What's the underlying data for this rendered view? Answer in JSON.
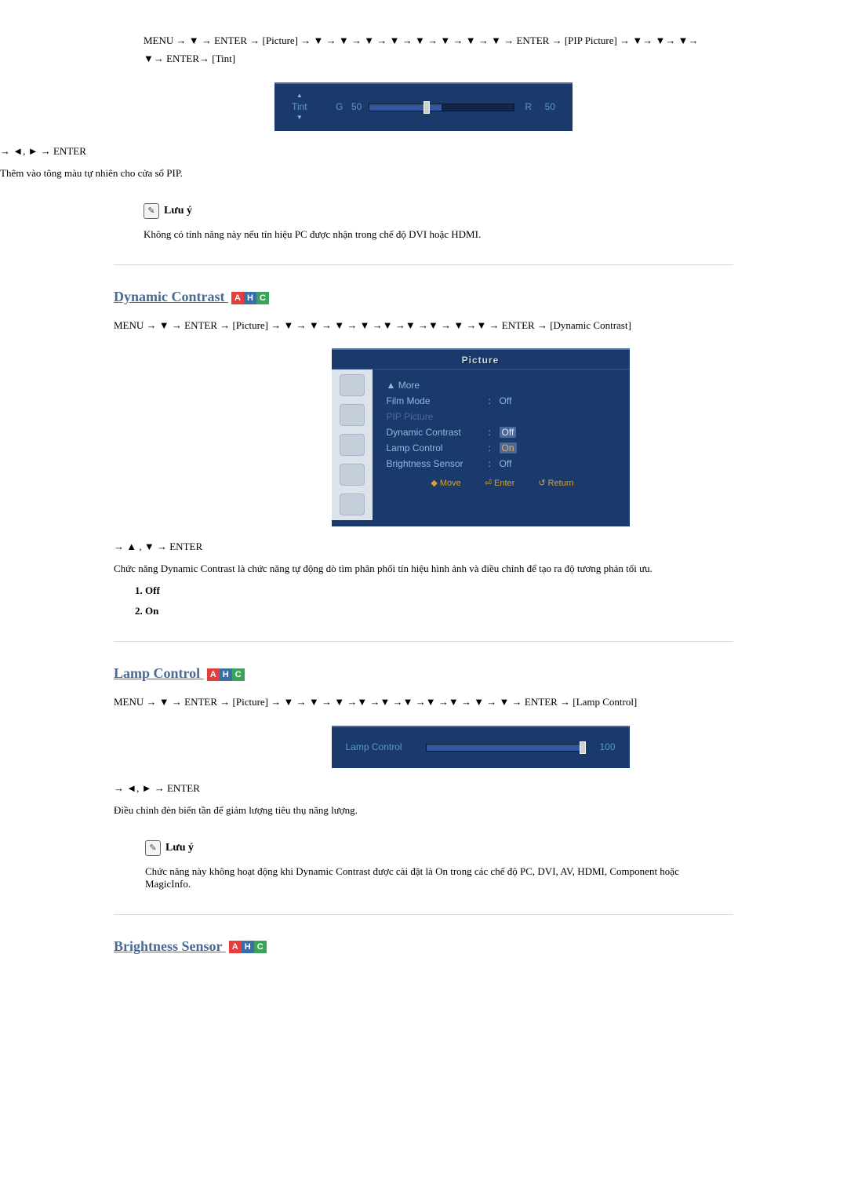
{
  "section_tint": {
    "nav": "MENU → ▼ → ENTER → [Picture] → ▼ → ▼ → ▼ → ▼ → ▼ → ▼ → ▼ → ▼ → ENTER → [PIP Picture] → ▼→ ▼→ ▼→ ▼→ ENTER→ [Tint]",
    "tint_label": "Tint",
    "g_label": "G",
    "g_value": "50",
    "r_label": "R",
    "r_value": "50",
    "post_nav": "→ ◄, ► → ENTER",
    "desc": "Thêm vào tông màu tự nhiên cho cửa sổ PIP.",
    "note_title": "Lưu ý",
    "note_text": "Không có tính năng này nếu tín hiệu PC được nhận trong chế độ DVI hoặc HDMI."
  },
  "section_dynamic": {
    "title": "Dynamic Contrast",
    "nav": "MENU → ▼ → ENTER → [Picture] → ▼ → ▼ → ▼ → ▼ →▼ →▼ →▼ → ▼ →▼ → ENTER → [Dynamic Contrast]",
    "osd_title": "Picture",
    "more": "▲ More",
    "rows": {
      "film_mode": {
        "lbl": "Film Mode",
        "val": "Off"
      },
      "pip_picture": {
        "lbl": "PIP Picture",
        "val": ""
      },
      "dynamic_contrast": {
        "lbl": "Dynamic Contrast",
        "val_off": "Off",
        "val_on": "On"
      },
      "lamp_control": {
        "lbl": "Lamp Control",
        "val": ""
      },
      "brightness_sensor": {
        "lbl": "Brightness Sensor",
        "val": "Off"
      }
    },
    "footer": {
      "move": "◆ Move",
      "enter": "⏎ Enter",
      "return": "↺ Return"
    },
    "post_nav": "→ ▲ , ▼ → ENTER",
    "desc": "Chức năng Dynamic Contrast là chức năng tự động dò tìm phân phối tín hiệu hình ảnh và điều chỉnh để tạo ra độ tương phản tối ưu.",
    "opt1": "Off",
    "opt2": "On"
  },
  "section_lamp": {
    "title": "Lamp Control",
    "nav": "MENU → ▼ → ENTER → [Picture] → ▼ → ▼ → ▼ →▼ →▼ →▼ →▼ →▼ → ▼ → ▼ → ENTER → [Lamp Control]",
    "lamp_label": "Lamp Control",
    "lamp_value": "100",
    "post_nav": "→ ◄, ► → ENTER",
    "desc": "Điều chỉnh đèn biến tần để giảm lượng tiêu thụ năng lượng.",
    "note_title": "Lưu ý",
    "note_text": "Chức năng này không hoạt động khi Dynamic Contrast được cài đặt là On trong các chế độ PC, DVI, AV, HDMI, Component hoặc MagicInfo."
  },
  "section_brightness": {
    "title": "Brightness Sensor"
  }
}
